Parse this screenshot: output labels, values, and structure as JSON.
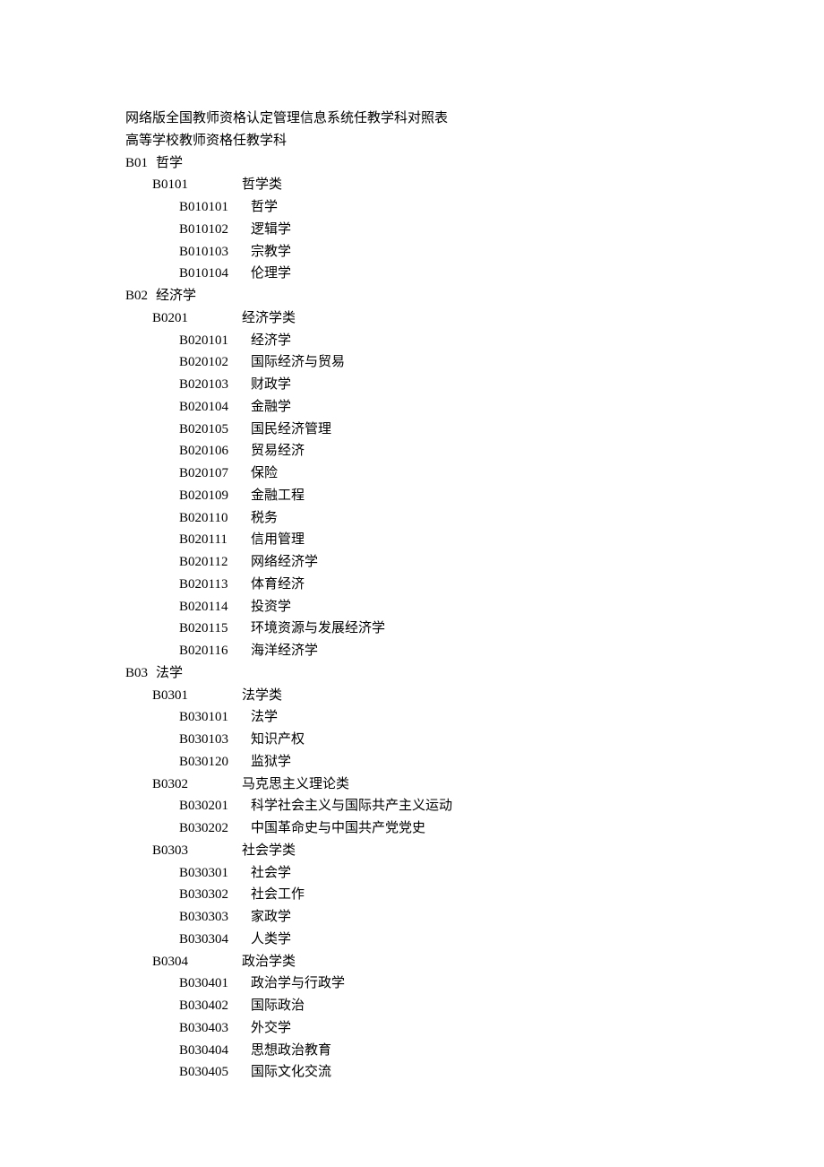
{
  "title": "网络版全国教师资格认定管理信息系统任教学科对照表",
  "subtitle": "高等学校教师资格任教学科",
  "categories": [
    {
      "code": "B01",
      "name": "哲学",
      "subcats": [
        {
          "code": "B0101",
          "name": "哲学类",
          "items": [
            {
              "code": "B010101",
              "name": "哲学"
            },
            {
              "code": "B010102",
              "name": "逻辑学"
            },
            {
              "code": "B010103",
              "name": "宗教学"
            },
            {
              "code": "B010104",
              "name": "伦理学"
            }
          ]
        }
      ]
    },
    {
      "code": "B02",
      "name": "经济学",
      "subcats": [
        {
          "code": "B0201",
          "name": "经济学类",
          "items": [
            {
              "code": "B020101",
              "name": "经济学"
            },
            {
              "code": "B020102",
              "name": "国际经济与贸易"
            },
            {
              "code": "B020103",
              "name": "财政学"
            },
            {
              "code": "B020104",
              "name": "金融学"
            },
            {
              "code": "B020105",
              "name": "国民经济管理"
            },
            {
              "code": "B020106",
              "name": "贸易经济"
            },
            {
              "code": "B020107",
              "name": "保险"
            },
            {
              "code": "B020109",
              "name": "金融工程"
            },
            {
              "code": "B020110",
              "name": "税务"
            },
            {
              "code": "B020111",
              "name": "信用管理"
            },
            {
              "code": "B020112",
              "name": "网络经济学"
            },
            {
              "code": "B020113",
              "name": "体育经济"
            },
            {
              "code": "B020114",
              "name": "投资学"
            },
            {
              "code": "B020115",
              "name": "环境资源与发展经济学"
            },
            {
              "code": "B020116",
              "name": "海洋经济学"
            }
          ]
        }
      ]
    },
    {
      "code": "B03",
      "name": "法学",
      "subcats": [
        {
          "code": "B0301",
          "name": "法学类",
          "items": [
            {
              "code": "B030101",
              "name": "法学"
            },
            {
              "code": "B030103",
              "name": "知识产权"
            },
            {
              "code": "B030120",
              "name": "监狱学"
            }
          ]
        },
        {
          "code": "B0302",
          "name": "马克思主义理论类",
          "items": [
            {
              "code": "B030201",
              "name": "科学社会主义与国际共产主义运动"
            },
            {
              "code": "B030202",
              "name": "中国革命史与中国共产党党史"
            }
          ]
        },
        {
          "code": "B0303",
          "name": "社会学类",
          "items": [
            {
              "code": "B030301",
              "name": "社会学"
            },
            {
              "code": "B030302",
              "name": "社会工作"
            },
            {
              "code": "B030303",
              "name": "家政学"
            },
            {
              "code": "B030304",
              "name": "人类学"
            }
          ]
        },
        {
          "code": "B0304",
          "name": "政治学类",
          "items": [
            {
              "code": "B030401",
              "name": "政治学与行政学"
            },
            {
              "code": "B030402",
              "name": "国际政治"
            },
            {
              "code": "B030403",
              "name": "外交学"
            },
            {
              "code": "B030404",
              "name": "思想政治教育"
            },
            {
              "code": "B030405",
              "name": "国际文化交流"
            }
          ]
        }
      ]
    }
  ]
}
